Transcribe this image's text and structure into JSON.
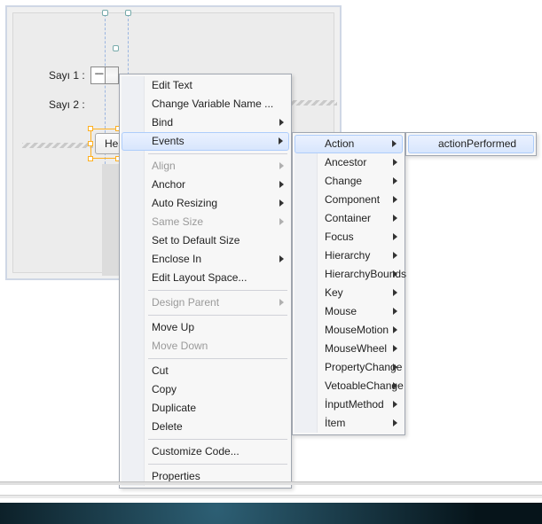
{
  "design": {
    "labels": {
      "sayi1": "Sayı 1 :",
      "sayi2": "Sayı 2 :"
    },
    "spinner_value": "----",
    "button_label": "Hesapla"
  },
  "context_menu": {
    "edit_text": "Edit Text",
    "change_var": "Change Variable Name ...",
    "bind": "Bind",
    "events": "Events",
    "align": "Align",
    "anchor": "Anchor",
    "auto_resizing": "Auto Resizing",
    "same_size": "Same Size",
    "default_size": "Set to Default Size",
    "enclose_in": "Enclose In",
    "edit_layout": "Edit Layout Space...",
    "design_parent": "Design Parent",
    "move_up": "Move Up",
    "move_down": "Move Down",
    "cut": "Cut",
    "copy": "Copy",
    "duplicate": "Duplicate",
    "delete": "Delete",
    "customize_code": "Customize Code...",
    "properties": "Properties"
  },
  "events_submenu": {
    "action": "Action",
    "ancestor": "Ancestor",
    "change": "Change",
    "component": "Component",
    "container": "Container",
    "focus": "Focus",
    "hierarchy": "Hierarchy",
    "hierarchy_bounds": "HierarchyBounds",
    "key": "Key",
    "mouse": "Mouse",
    "mouse_motion": "MouseMotion",
    "mouse_wheel": "MouseWheel",
    "property_change": "PropertyChange",
    "vetoable_change": "VetoableChange",
    "input_method": "İnputMethod",
    "item": "İtem"
  },
  "action_submenu": {
    "action_performed": "actionPerformed"
  }
}
